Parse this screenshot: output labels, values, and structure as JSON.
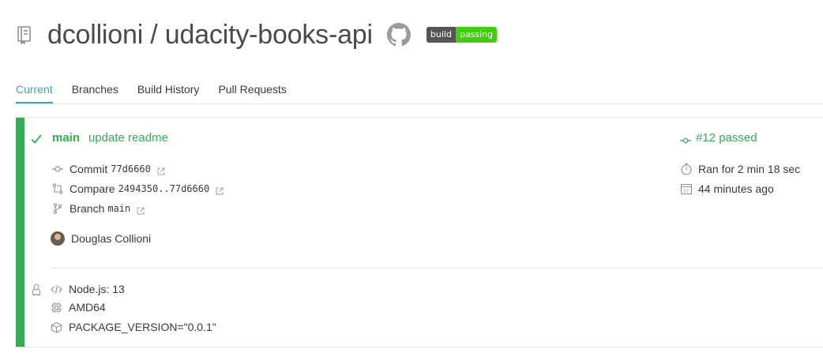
{
  "header": {
    "title": "dcollioni / udacity-books-api",
    "badge_left": "build",
    "badge_right": "passing",
    "icons": [
      "repo-icon",
      "github-icon"
    ]
  },
  "tabs": [
    {
      "label": "Current",
      "active": true
    },
    {
      "label": "Branches",
      "active": false
    },
    {
      "label": "Build History",
      "active": false
    },
    {
      "label": "Pull Requests",
      "active": false
    }
  ],
  "build": {
    "status": "passed",
    "status_color": "#39aa56",
    "branch": "main",
    "message": "update readme",
    "number": "#12 passed",
    "commit_label": "Commit",
    "commit_sha": "77d6660",
    "compare_label": "Compare",
    "compare_range": "2494350..77d6660",
    "branch_label": "Branch",
    "branch_value": "main",
    "author": "Douglas Collioni",
    "duration": "Ran for 2 min 18 sec",
    "finished": "44 minutes ago"
  },
  "job": {
    "os_icon": "linux-icon",
    "language": "Node.js: 13",
    "arch": "AMD64",
    "env": "PACKAGE_VERSION=\"0.0.1\""
  },
  "colors": {
    "accent": "#3da1b6",
    "passed": "#39aa56",
    "badge_dark": "#555555",
    "badge_green": "#44cc11"
  }
}
